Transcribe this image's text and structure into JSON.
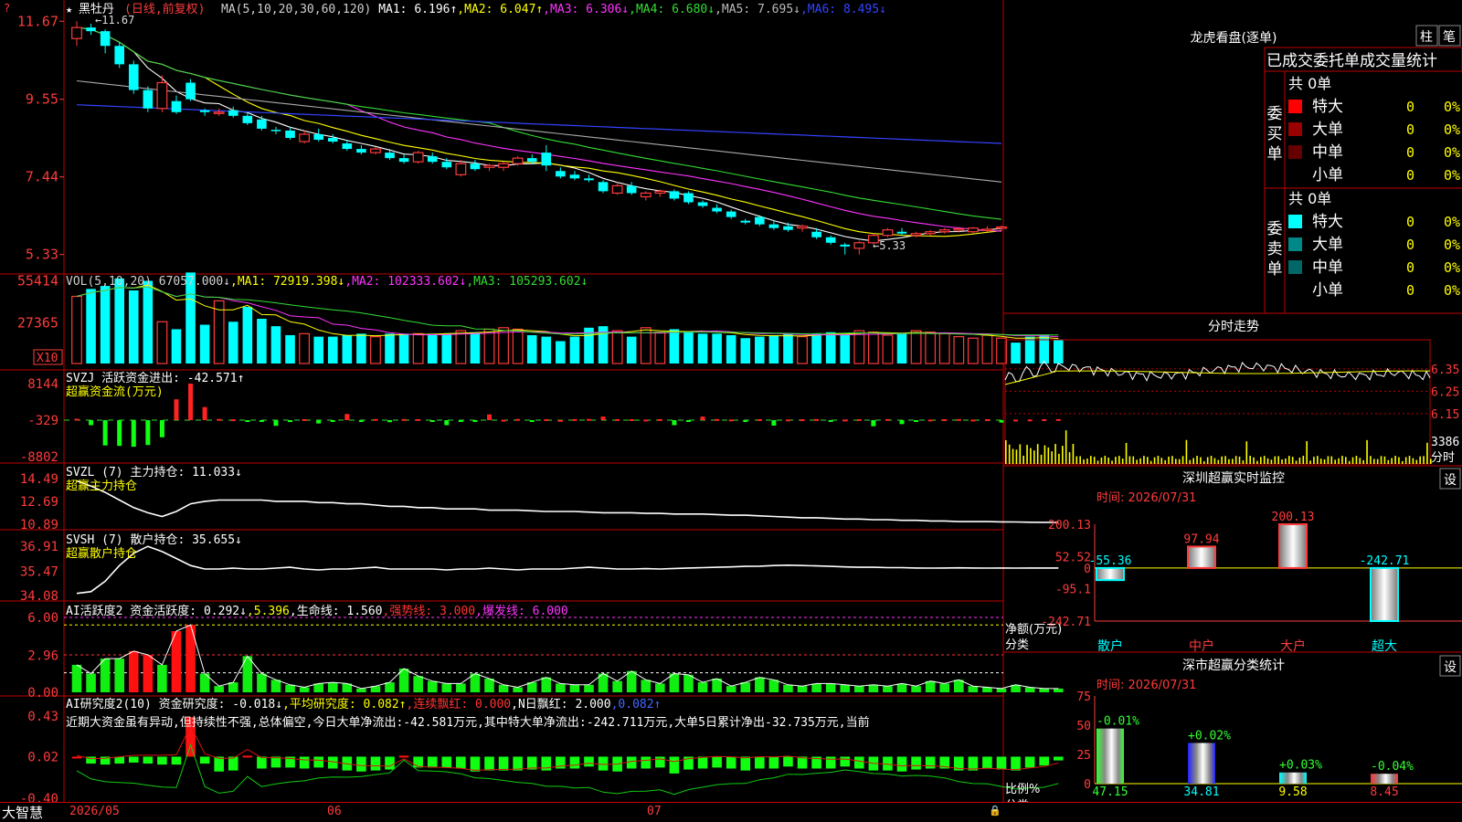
{
  "stock": {
    "name": "黑牡丹",
    "period_note": "(日线,前复权)"
  },
  "ma_header": [
    {
      "label": "MA(5,10,20,30,60,120)",
      "color": "#d0d0d0"
    },
    {
      "label": " MA1: 6.196↑",
      "color": "#ffffff"
    },
    {
      "label": ",MA2: 6.047↑",
      "color": "#ffff00"
    },
    {
      "label": ",MA3: 6.306↓",
      "color": "#ff33ff"
    },
    {
      "label": ",MA4: 6.680↓",
      "color": "#33dd33"
    },
    {
      "label": ",MA5: 7.695↓",
      "color": "#bbbbbb"
    },
    {
      "label": ",MA6: 8.495↓",
      "color": "#3344ff"
    }
  ],
  "main_axis": [
    "11.67",
    "9.55",
    "7.44",
    "5.33"
  ],
  "extreme_marks": {
    "high": "11.67",
    "low": "5.33"
  },
  "vol_header": [
    {
      "label": "VOL(5,10,20) 67057.000↓",
      "color": "#d0d0d0"
    },
    {
      "label": ",MA1: 72919.398↓",
      "color": "#ffff00"
    },
    {
      "label": ",MA2: 102333.602↓",
      "color": "#ff33ff"
    },
    {
      "label": ",MA3: 105293.602↓",
      "color": "#33dd33"
    }
  ],
  "vol_axis": [
    "55414",
    "27365"
  ],
  "vol_unit": "X10",
  "svzj": {
    "title": "SVZJ  活跃资金进出: -42.571↑",
    "subtitle": "超赢资金流(万元)",
    "axis": [
      "8144",
      "-329",
      "-8802"
    ]
  },
  "svzl": {
    "title": "SVZL (7) 主力持仓: 11.033↓",
    "subtitle": "超赢主力持仓",
    "axis": [
      "14.49",
      "12.69",
      "10.89"
    ]
  },
  "svsh": {
    "title": "SVSH (7) 散户持仓: 35.655↓",
    "subtitle": "超赢散户持仓",
    "axis": [
      "36.91",
      "35.47",
      "34.08"
    ]
  },
  "ai_active": {
    "header": [
      {
        "label": "AI活跃度2 资金活跃度: 0.292↓",
        "color": "#ffffff"
      },
      {
        "label": ",5.396",
        "color": "#ffff00"
      },
      {
        "label": ",生命线: 1.560",
        "color": "#ffffff"
      },
      {
        "label": ",强势线: 3.000",
        "color": "#ff3333"
      },
      {
        "label": ",爆发线: 6.000",
        "color": "#ff33ff"
      }
    ],
    "axis": [
      "6.00",
      "2.96",
      "0.00"
    ]
  },
  "ai_research": {
    "header": [
      {
        "label": "AI研究度2(10) 资金研究度: -0.018↓",
        "color": "#ffffff"
      },
      {
        "label": ",平均研究度: 0.082↑",
        "color": "#ffff00"
      },
      {
        "label": ",连续飘红: 0.000",
        "color": "#ff3333"
      },
      {
        "label": ",N日飘红: 2.000",
        "color": "#ffffff"
      },
      {
        "label": ",0.082↑",
        "color": "#4466ff"
      }
    ],
    "comment": "近期大资金虽有异动,但持续性不强,总体偏空,今日大单净流出:-42.581万元,其中特大单净流出:-242.711万元,大单5日累计净出-32.735万元,当前",
    "axis": [
      "0.43",
      "0.02",
      "-0.40"
    ]
  },
  "x_dates": [
    "2026/05",
    "06",
    "07"
  ],
  "logo": "大智慧",
  "longhu": {
    "title": "龙虎看盘(逐单)",
    "btn1": "柱",
    "btn2": "笔",
    "subtitle": "已成交委托单成交量统计",
    "buy_label": "委买单",
    "sell_label": "委卖单",
    "buy_total": "共 0单",
    "sell_total": "共 0单",
    "buy_rows": [
      {
        "label": "特大",
        "count": "0",
        "pct": "0%",
        "color": "#ff0000"
      },
      {
        "label": "大单",
        "count": "0",
        "pct": "0%",
        "color": "#990000"
      },
      {
        "label": "中单",
        "count": "0",
        "pct": "0%",
        "color": "#660000"
      },
      {
        "label": "小单",
        "count": "0",
        "pct": "0%",
        "color": ""
      }
    ],
    "sell_rows": [
      {
        "label": "特大",
        "count": "0",
        "pct": "0%",
        "color": "#00ffff"
      },
      {
        "label": "大单",
        "count": "0",
        "pct": "0%",
        "color": "#008888"
      },
      {
        "label": "中单",
        "count": "0",
        "pct": "0%",
        "color": "#006666"
      },
      {
        "label": "小单",
        "count": "0",
        "pct": "0%",
        "color": ""
      }
    ]
  },
  "fenshi": {
    "title": "分时走势",
    "axis": [
      "6.35",
      "6.25",
      "6.15"
    ],
    "vol_max": "3386",
    "vol_label": "分时"
  },
  "monitor": {
    "title": "深圳超赢实时监控",
    "btn": "设",
    "date_line": "时间: 2026/07/31",
    "axis": [
      "200.13",
      "52.52",
      "0",
      "-95.1",
      "-242.71"
    ],
    "y_label": "净额(万元)",
    "x_label": "分类"
  },
  "classify": {
    "title": "深市超赢分类统计",
    "btn": "设",
    "date_line": "时间: 2026/07/31",
    "axis": [
      "75",
      "50",
      "25",
      "0"
    ],
    "y_label": "比例%",
    "x_label": "分类"
  },
  "chart_data": [
    {
      "type": "candlestick",
      "name": "黑牡丹 日线 前复权",
      "ohlc": [
        [
          11.2,
          11.67,
          11.0,
          11.5
        ],
        [
          11.5,
          11.6,
          11.3,
          11.4
        ],
        [
          11.4,
          11.45,
          10.8,
          11.0
        ],
        [
          11.0,
          11.1,
          10.4,
          10.5
        ],
        [
          10.5,
          10.6,
          9.7,
          9.8
        ],
        [
          9.8,
          9.9,
          9.2,
          9.3
        ],
        [
          9.3,
          10.2,
          9.2,
          10.0
        ],
        [
          9.5,
          9.65,
          9.15,
          9.2
        ],
        [
          10.0,
          10.1,
          9.5,
          9.55
        ],
        [
          9.25,
          9.3,
          9.1,
          9.2
        ],
        [
          9.2,
          9.3,
          9.1,
          9.2
        ],
        [
          9.25,
          9.35,
          9.05,
          9.1
        ],
        [
          9.1,
          9.2,
          8.85,
          8.9
        ],
        [
          9.0,
          9.1,
          8.7,
          8.75
        ],
        [
          8.72,
          8.8,
          8.6,
          8.7
        ],
        [
          8.7,
          8.8,
          8.45,
          8.5
        ],
        [
          8.4,
          8.7,
          8.35,
          8.6
        ],
        [
          8.6,
          8.75,
          8.4,
          8.45
        ],
        [
          8.5,
          8.6,
          8.35,
          8.4
        ],
        [
          8.35,
          8.45,
          8.15,
          8.2
        ],
        [
          8.2,
          8.3,
          8.05,
          8.1
        ],
        [
          8.1,
          8.25,
          8.05,
          8.2
        ],
        [
          8.1,
          8.2,
          7.9,
          7.95
        ],
        [
          7.95,
          8.05,
          7.8,
          7.85
        ],
        [
          7.85,
          8.15,
          7.8,
          8.1
        ],
        [
          8.0,
          8.1,
          7.8,
          7.85
        ],
        [
          7.85,
          7.95,
          7.65,
          7.7
        ],
        [
          7.5,
          7.9,
          7.45,
          7.8
        ],
        [
          7.8,
          7.9,
          7.6,
          7.65
        ],
        [
          7.7,
          7.8,
          7.6,
          7.75
        ],
        [
          7.7,
          7.85,
          7.6,
          7.8
        ],
        [
          7.8,
          8.0,
          7.75,
          7.95
        ],
        [
          7.95,
          8.05,
          7.8,
          7.85
        ],
        [
          8.1,
          8.3,
          7.6,
          7.75
        ],
        [
          7.6,
          7.7,
          7.4,
          7.45
        ],
        [
          7.5,
          7.6,
          7.35,
          7.4
        ],
        [
          7.4,
          7.5,
          7.3,
          7.35
        ],
        [
          7.3,
          7.35,
          7.0,
          7.05
        ],
        [
          7.0,
          7.3,
          6.95,
          7.2
        ],
        [
          7.2,
          7.3,
          6.95,
          7.0
        ],
        [
          6.9,
          7.05,
          6.8,
          7.0
        ],
        [
          7.0,
          7.1,
          6.9,
          7.05
        ],
        [
          7.05,
          7.1,
          6.8,
          6.85
        ],
        [
          7.0,
          7.05,
          6.7,
          6.75
        ],
        [
          6.75,
          6.8,
          6.6,
          6.65
        ],
        [
          6.6,
          6.7,
          6.45,
          6.5
        ],
        [
          6.5,
          6.55,
          6.3,
          6.35
        ],
        [
          6.25,
          6.3,
          6.15,
          6.2
        ],
        [
          6.35,
          6.4,
          6.1,
          6.15
        ],
        [
          6.15,
          6.25,
          6.0,
          6.05
        ],
        [
          6.1,
          6.2,
          5.95,
          6.0
        ],
        [
          6.05,
          6.15,
          5.95,
          6.1
        ],
        [
          5.95,
          6.05,
          5.75,
          5.8
        ],
        [
          5.8,
          5.85,
          5.6,
          5.65
        ],
        [
          5.6,
          5.65,
          5.33,
          5.55
        ],
        [
          5.5,
          5.7,
          5.33,
          5.65
        ],
        [
          5.65,
          5.9,
          5.6,
          5.85
        ],
        [
          5.85,
          6.05,
          5.8,
          6.0
        ],
        [
          5.95,
          6.05,
          5.85,
          5.9
        ],
        [
          5.85,
          5.95,
          5.8,
          5.9
        ],
        [
          5.9,
          6.0,
          5.85,
          5.95
        ],
        [
          5.95,
          6.05,
          5.9,
          6.0
        ],
        [
          6.0,
          6.08,
          5.93,
          6.03
        ],
        [
          5.95,
          6.08,
          5.9,
          6.05
        ],
        [
          6.0,
          6.1,
          5.95,
          6.02
        ],
        [
          6.05,
          6.12,
          5.98,
          6.08
        ]
      ],
      "ylim": [
        5.0,
        11.9
      ]
    },
    {
      "type": "bar",
      "name": "VOL",
      "values": [
        45000,
        50000,
        52000,
        57000,
        49000,
        55414,
        28000,
        23000,
        61000,
        26000,
        42000,
        28000,
        38000,
        30000,
        25000,
        19000,
        20000,
        18000,
        18000,
        19000,
        20000,
        18000,
        20000,
        20000,
        20000,
        20000,
        20000,
        22000,
        21000,
        23000,
        24000,
        23000,
        19000,
        18000,
        15000,
        18000,
        24000,
        25000,
        22000,
        18000,
        24000,
        21000,
        23000,
        21000,
        20000,
        20000,
        19000,
        17000,
        18000,
        19000,
        20000,
        18000,
        20000,
        21000,
        20000,
        22000,
        21000,
        19000,
        20000,
        22000,
        21000,
        20000,
        18000,
        17000,
        19000,
        17000,
        14000,
        18000,
        19000,
        16000
      ],
      "ylim": [
        0,
        60000
      ]
    },
    {
      "type": "bar",
      "name": "SVZJ",
      "values": [
        0,
        -1500,
        -6200,
        -6300,
        -6500,
        -6100,
        -4300,
        4500,
        8144,
        2700,
        -50,
        -140,
        -650,
        -430,
        -1650,
        -780,
        -100,
        -1100,
        -400,
        1100,
        -430,
        -60,
        -800,
        -80,
        -90,
        -380,
        -1500,
        -350,
        -380,
        1000,
        -240,
        -60,
        -480,
        -100,
        -300,
        -80,
        -50,
        500,
        -100,
        -120,
        -200,
        -100,
        -1500,
        -330,
        500,
        -80,
        -180,
        -520,
        -110,
        -1600,
        -180,
        -130,
        -90,
        -450,
        -200,
        -110,
        -1750,
        -80,
        -1250,
        -450,
        -200,
        -120,
        -80,
        -210,
        -120,
        -900,
        -200,
        -180,
        -120,
        -90
      ],
      "ylim": [
        -8802,
        8144
      ]
    },
    {
      "type": "line",
      "name": "主力持仓",
      "values": [
        14.3,
        13.9,
        13.4,
        12.8,
        12.2,
        11.8,
        11.5,
        11.9,
        12.5,
        12.7,
        12.8,
        12.8,
        12.8,
        12.8,
        12.7,
        12.7,
        12.7,
        12.6,
        12.6,
        12.5,
        12.5,
        12.4,
        12.3,
        12.3,
        12.2,
        12.2,
        12.1,
        12.1,
        12.1,
        12.0,
        12.0,
        12.0,
        11.95,
        11.9,
        11.9,
        11.9,
        11.85,
        11.8,
        11.8,
        11.8,
        11.75,
        11.75,
        11.7,
        11.7,
        11.7,
        11.65,
        11.6,
        11.6,
        11.55,
        11.5,
        11.45,
        11.4,
        11.4,
        11.35,
        11.3,
        11.3,
        11.25,
        11.25,
        11.2,
        11.2,
        11.15,
        11.15,
        11.1,
        11.1,
        11.1,
        11.08,
        11.07,
        11.05,
        11.04,
        11.033
      ],
      "ylim": [
        10.89,
        14.49
      ]
    },
    {
      "type": "line",
      "name": "散户持仓",
      "values": [
        34.2,
        34.3,
        34.9,
        35.8,
        36.5,
        36.9,
        36.6,
        36.2,
        35.8,
        35.6,
        35.6,
        35.65,
        35.6,
        35.6,
        35.65,
        35.7,
        35.6,
        35.55,
        35.6,
        35.6,
        35.65,
        35.7,
        35.6,
        35.6,
        35.6,
        35.6,
        35.55,
        35.6,
        35.6,
        35.65,
        35.6,
        35.55,
        35.6,
        35.6,
        35.6,
        35.65,
        35.7,
        35.65,
        35.6,
        35.6,
        35.62,
        35.6,
        35.63,
        35.66,
        35.68,
        35.7,
        35.72,
        35.75,
        35.76,
        35.8,
        35.82,
        35.8,
        35.78,
        35.75,
        35.72,
        35.7,
        35.7,
        35.68,
        35.68,
        35.66,
        35.65,
        35.66,
        35.67,
        35.66,
        35.65,
        35.66,
        35.65,
        35.655,
        35.655,
        35.655
      ],
      "ylim": [
        34.08,
        36.91
      ]
    },
    {
      "type": "bar",
      "name": "AI活跃度2",
      "values": [
        2.2,
        1.5,
        2.7,
        2.7,
        3.3,
        3.0,
        2.2,
        4.9,
        5.4,
        1.5,
        0.5,
        0.8,
        2.9,
        1.5,
        1.0,
        0.6,
        0.4,
        0.7,
        0.8,
        0.7,
        0.3,
        0.5,
        0.8,
        1.9,
        1.3,
        0.9,
        0.7,
        0.7,
        1.5,
        1.1,
        0.6,
        0.4,
        0.8,
        1.2,
        0.7,
        0.6,
        0.6,
        1.5,
        0.9,
        1.7,
        1.0,
        0.7,
        1.5,
        1.4,
        0.8,
        1.1,
        0.5,
        0.8,
        1.2,
        1.0,
        0.6,
        0.5,
        0.7,
        0.7,
        0.6,
        0.5,
        0.6,
        0.5,
        0.7,
        0.5,
        0.9,
        0.7,
        1.0,
        0.5,
        0.4,
        0.3,
        0.6,
        0.4,
        0.3,
        0.3
      ],
      "ylim": [
        0,
        6.0
      ]
    },
    {
      "type": "bar",
      "name": "资金研究度",
      "values": [
        0.02,
        -0.05,
        -0.06,
        -0.05,
        -0.04,
        -0.05,
        -0.06,
        -0.06,
        0.42,
        -0.05,
        -0.13,
        -0.12,
        0.03,
        -0.1,
        -0.09,
        -0.09,
        -0.1,
        -0.09,
        -0.1,
        -0.12,
        -0.13,
        -0.12,
        -0.11,
        0.03,
        -0.09,
        -0.09,
        -0.09,
        -0.1,
        -0.13,
        -0.12,
        -0.12,
        -0.12,
        -0.11,
        -0.12,
        -0.1,
        -0.1,
        -0.08,
        -0.12,
        -0.13,
        -0.1,
        -0.1,
        -0.09,
        -0.15,
        -0.11,
        -0.1,
        -0.09,
        -0.1,
        -0.12,
        -0.1,
        -0.1,
        -0.08,
        -0.1,
        -0.1,
        -0.1,
        -0.08,
        -0.1,
        -0.12,
        -0.12,
        -0.13,
        -0.11,
        -0.1,
        -0.1,
        -0.12,
        -0.12,
        -0.1,
        -0.11,
        -0.12,
        -0.09,
        -0.07,
        -0.018
      ],
      "ylim": [
        -0.4,
        0.43
      ]
    },
    {
      "type": "bar",
      "name": "深圳超赢实时监控",
      "categories": [
        "散户",
        "中户",
        "大户",
        "超大"
      ],
      "values": [
        -55.36,
        97.94,
        200.13,
        -242.71
      ],
      "ylim": [
        -242.71,
        200.13
      ]
    },
    {
      "type": "bar",
      "name": "深市超赢分类统计",
      "categories": [
        "散户",
        "中户",
        "大户",
        "超大"
      ],
      "values": [
        47.15,
        34.81,
        9.58,
        8.45
      ],
      "changes": [
        "-0.01%",
        "+0.02%",
        "+0.03%",
        "-0.04%"
      ],
      "ylim": [
        0,
        75
      ]
    }
  ]
}
